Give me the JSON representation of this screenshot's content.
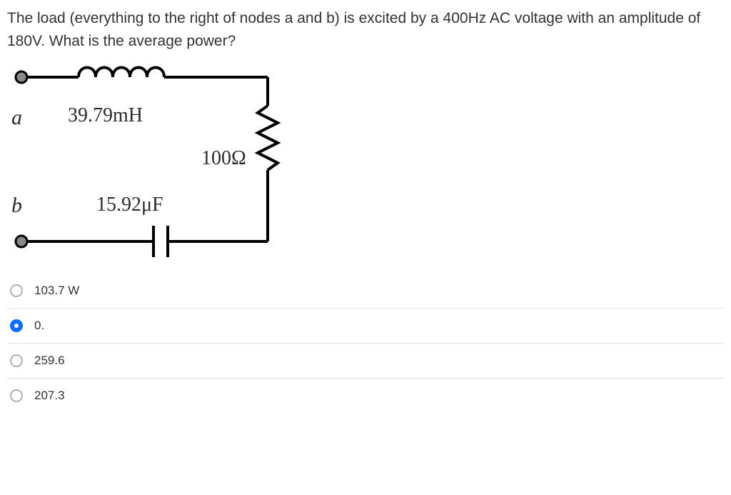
{
  "question": "The load (everything to the right of nodes a and b) is excited by a 400Hz AC voltage with an amplitude of 180V. What is the average power?",
  "circuit": {
    "node_a": "a",
    "node_b": "b",
    "inductor": "39.79mH",
    "capacitor": "15.92μF",
    "resistor": "100Ω"
  },
  "options": [
    {
      "value": "103.7 W",
      "selected": false
    },
    {
      "value": "0.",
      "selected": true
    },
    {
      "value": "259.6",
      "selected": false
    },
    {
      "value": "207.3",
      "selected": false
    }
  ]
}
